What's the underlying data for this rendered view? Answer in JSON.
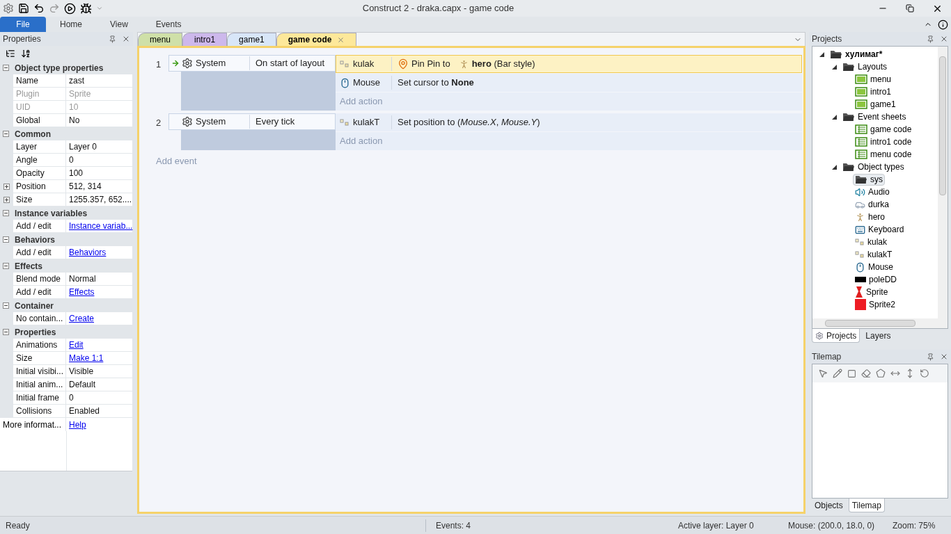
{
  "window": {
    "title": "Construct 2 - draka.capx - game code"
  },
  "ribbon_tabs": [
    {
      "label": "File",
      "selected": true
    },
    {
      "label": "Home",
      "selected": false
    },
    {
      "label": "View",
      "selected": false
    },
    {
      "label": "Events",
      "selected": false
    }
  ],
  "properties": {
    "title": "Properties",
    "sections": [
      {
        "title": "Object type properties",
        "expanded": true,
        "rows": [
          {
            "label": "Name",
            "value": "zast",
            "kind": "text",
            "disabled": false,
            "expandable": false
          },
          {
            "label": "Plugin",
            "value": "Sprite",
            "kind": "text",
            "disabled": true,
            "expandable": false
          },
          {
            "label": "UID",
            "value": "10",
            "kind": "text",
            "disabled": true,
            "expandable": false
          },
          {
            "label": "Global",
            "value": "No",
            "kind": "text",
            "disabled": false,
            "expandable": false
          }
        ]
      },
      {
        "title": "Common",
        "expanded": true,
        "rows": [
          {
            "label": "Layer",
            "value": "Layer 0",
            "kind": "text",
            "disabled": false,
            "expandable": false
          },
          {
            "label": "Angle",
            "value": "0",
            "kind": "text",
            "disabled": false,
            "expandable": false
          },
          {
            "label": "Opacity",
            "value": "100",
            "kind": "text",
            "disabled": false,
            "expandable": false
          },
          {
            "label": "Position",
            "value": "512, 314",
            "kind": "text",
            "disabled": false,
            "expandable": true
          },
          {
            "label": "Size",
            "value": "1255.357, 652....",
            "kind": "text",
            "disabled": false,
            "expandable": true
          }
        ]
      },
      {
        "title": "Instance variables",
        "expanded": true,
        "rows": [
          {
            "label": "Add / edit",
            "value": "Instance variab...",
            "kind": "link",
            "disabled": false,
            "expandable": false
          }
        ]
      },
      {
        "title": "Behaviors",
        "expanded": true,
        "rows": [
          {
            "label": "Add / edit",
            "value": "Behaviors",
            "kind": "link",
            "disabled": false,
            "expandable": false
          }
        ]
      },
      {
        "title": "Effects",
        "expanded": true,
        "rows": [
          {
            "label": "Blend mode",
            "value": "Normal",
            "kind": "text",
            "disabled": false,
            "expandable": false
          },
          {
            "label": "Add / edit",
            "value": "Effects",
            "kind": "link",
            "disabled": false,
            "expandable": false
          }
        ]
      },
      {
        "title": "Container",
        "expanded": true,
        "rows": [
          {
            "label": "No contain...",
            "value": "Create",
            "kind": "link",
            "disabled": false,
            "expandable": false
          }
        ]
      },
      {
        "title": "Properties",
        "expanded": true,
        "rows": [
          {
            "label": "Animations",
            "value": "Edit",
            "kind": "link",
            "disabled": false,
            "expandable": false
          },
          {
            "label": "Size",
            "value": "Make 1:1",
            "kind": "link",
            "disabled": false,
            "expandable": false
          },
          {
            "label": "Initial visibi...",
            "value": "Visible",
            "kind": "text",
            "disabled": false,
            "expandable": false
          },
          {
            "label": "Initial anim...",
            "value": "Default",
            "kind": "text",
            "disabled": false,
            "expandable": false
          },
          {
            "label": "Initial frame",
            "value": "0",
            "kind": "text",
            "disabled": false,
            "expandable": false
          },
          {
            "label": "Collisions",
            "value": "Enabled",
            "kind": "text",
            "disabled": false,
            "expandable": false
          }
        ]
      }
    ],
    "footer": {
      "label": "More informat...",
      "value": "Help"
    }
  },
  "doc_tabs": [
    {
      "label": "menu",
      "selected": false,
      "color": "#cfe0a8"
    },
    {
      "label": "intro1",
      "selected": false,
      "color": "#cdb8ec"
    },
    {
      "label": "game1",
      "selected": false,
      "color": "#d8e6f8"
    },
    {
      "label": "game code",
      "selected": true,
      "color": "#fde89a"
    }
  ],
  "events": [
    {
      "number": "1",
      "trigger": true,
      "conditions": [
        {
          "object": "System",
          "text": "On start of layout"
        }
      ],
      "actions": [
        {
          "kind": "pin",
          "object": "kulak",
          "selected": true,
          "text": "Pin Pin to",
          "param": "**hero** (Bar style)"
        },
        {
          "kind": "mouse",
          "object": "Mouse",
          "selected": false,
          "text": "Set cursor to **None**"
        }
      ],
      "add_action": "Add action"
    },
    {
      "number": "2",
      "trigger": false,
      "conditions": [
        {
          "object": "System",
          "text": "Every tick"
        }
      ],
      "actions": [
        {
          "kind": "sprite",
          "object": "kulakT",
          "selected": false,
          "text": "Set position to (*Mouse.X*, *Mouse.Y*)"
        }
      ],
      "add_action": "Add action"
    }
  ],
  "add_event": "Add event",
  "projects": {
    "title": "Projects",
    "tree": [
      {
        "label": "хулимаг*",
        "kind": "folder",
        "bold": true,
        "selected": false,
        "expanded": true,
        "children": [
          {
            "label": "Layouts",
            "kind": "folder",
            "bold": false,
            "selected": false,
            "expanded": true,
            "children": [
              {
                "label": "menu",
                "kind": "layout",
                "bold": false,
                "selected": false
              },
              {
                "label": "intro1",
                "kind": "layout",
                "bold": false,
                "selected": false
              },
              {
                "label": "game1",
                "kind": "layout",
                "bold": false,
                "selected": false
              }
            ]
          },
          {
            "label": "Event sheets",
            "kind": "folder",
            "bold": false,
            "selected": false,
            "expanded": true,
            "children": [
              {
                "label": "game code",
                "kind": "sheet",
                "bold": false,
                "selected": false
              },
              {
                "label": "intro1 code",
                "kind": "sheet",
                "bold": false,
                "selected": false
              },
              {
                "label": "menu code",
                "kind": "sheet",
                "bold": false,
                "selected": false
              }
            ]
          },
          {
            "label": "Object types",
            "kind": "folder",
            "bold": false,
            "selected": false,
            "expanded": true,
            "children": [
              {
                "label": "sys",
                "kind": "folder",
                "bold": false,
                "selected": true
              },
              {
                "label": "Audio",
                "kind": "audio",
                "bold": false,
                "selected": false
              },
              {
                "label": "durka",
                "kind": "vehicle",
                "bold": false,
                "selected": false
              },
              {
                "label": "hero",
                "kind": "figure",
                "bold": false,
                "selected": false
              },
              {
                "label": "Keyboard",
                "kind": "keyboard",
                "bold": false,
                "selected": false
              },
              {
                "label": "kulak",
                "kind": "sprite",
                "bold": false,
                "selected": false
              },
              {
                "label": "kulakT",
                "kind": "sprite",
                "bold": false,
                "selected": false
              },
              {
                "label": "Mouse",
                "kind": "mouse",
                "bold": false,
                "selected": false
              },
              {
                "label": "poleDD",
                "kind": "bar",
                "bold": false,
                "selected": false
              },
              {
                "label": "Sprite",
                "kind": "dress",
                "bold": false,
                "selected": false
              },
              {
                "label": "Sprite2",
                "kind": "square",
                "bold": false,
                "selected": false
              }
            ]
          }
        ]
      }
    ],
    "tabs": [
      {
        "label": "Projects",
        "selected": true
      },
      {
        "label": "Layers",
        "selected": false
      }
    ]
  },
  "tilemap": {
    "title": "Tilemap",
    "tabs": [
      {
        "label": "Objects",
        "selected": false
      },
      {
        "label": "Tilemap",
        "selected": true
      }
    ]
  },
  "status_bar": {
    "ready": "Ready",
    "events": "Events: 4",
    "layer": "Active layer: Layer 0",
    "mouse": "Mouse: (200.0, 18.0, 0)",
    "zoom": "Zoom: 75%"
  }
}
